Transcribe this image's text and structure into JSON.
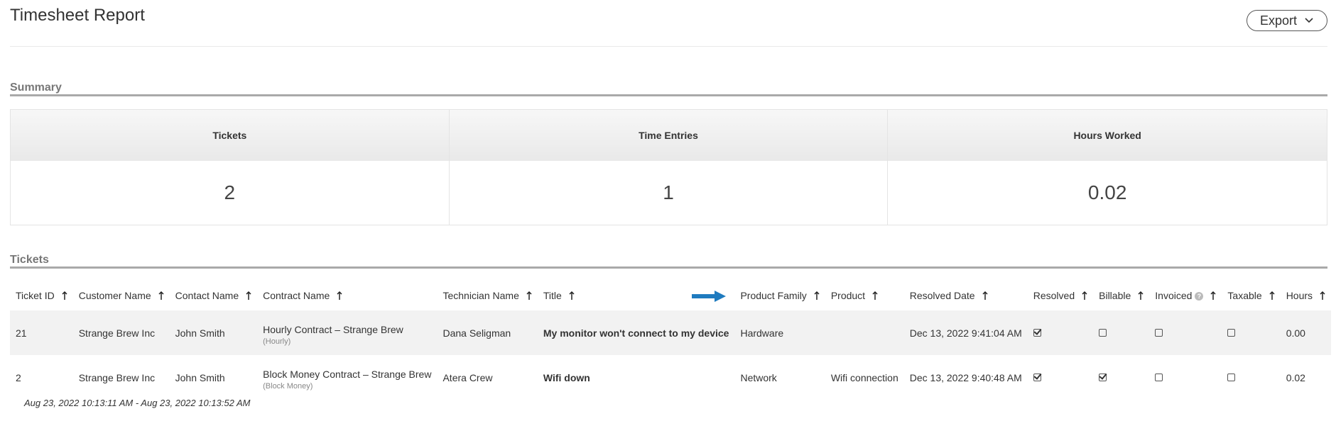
{
  "page": {
    "title": "Timesheet Report"
  },
  "export": {
    "label": "Export",
    "icon": "chevron-down-icon"
  },
  "summary": {
    "heading": "Summary",
    "columns": [
      {
        "label": "Tickets",
        "value": "2"
      },
      {
        "label": "Time Entries",
        "value": "1"
      },
      {
        "label": "Hours Worked",
        "value": "0.02"
      }
    ]
  },
  "tickets": {
    "heading": "Tickets",
    "columns": [
      "Ticket ID",
      "Customer Name",
      "Contact Name",
      "Contract Name",
      "Technician Name",
      "Title",
      "Product Family",
      "Product",
      "Resolved Date",
      "Resolved",
      "Billable",
      "Invoiced",
      "Taxable",
      "Hours"
    ],
    "rows": [
      {
        "ticket_id": "21",
        "customer": "Strange Brew Inc",
        "contact": "John Smith",
        "contract": "Hourly Contract – Strange Brew",
        "contract_type": "(Hourly)",
        "technician": "Dana Seligman",
        "title": "My monitor won't connect to my device",
        "product_family": "Hardware",
        "product": "",
        "resolved_date": "Dec 13, 2022 9:41:04 AM",
        "resolved": true,
        "billable": false,
        "invoiced": false,
        "taxable": false,
        "hours": "0.00"
      },
      {
        "ticket_id": "2",
        "customer": "Strange Brew Inc",
        "contact": "John Smith",
        "contract": "Block Money Contract – Strange Brew",
        "contract_type": "(Block Money)",
        "technician": "Atera Crew",
        "title": "Wifi down",
        "product_family": "Network",
        "product": "Wifi connection",
        "resolved_date": "Dec 13, 2022 9:40:48 AM",
        "resolved": true,
        "billable": true,
        "invoiced": false,
        "taxable": false,
        "hours": "0.02"
      }
    ]
  },
  "footer": {
    "date_range": "Aug 23, 2022 10:13:11 AM - Aug 23, 2022 10:13:52 AM"
  },
  "colors": {
    "accent_arrow": "#1f7bbf",
    "rule": "#a9a9a9",
    "row_shade": "#f2f2f2"
  }
}
